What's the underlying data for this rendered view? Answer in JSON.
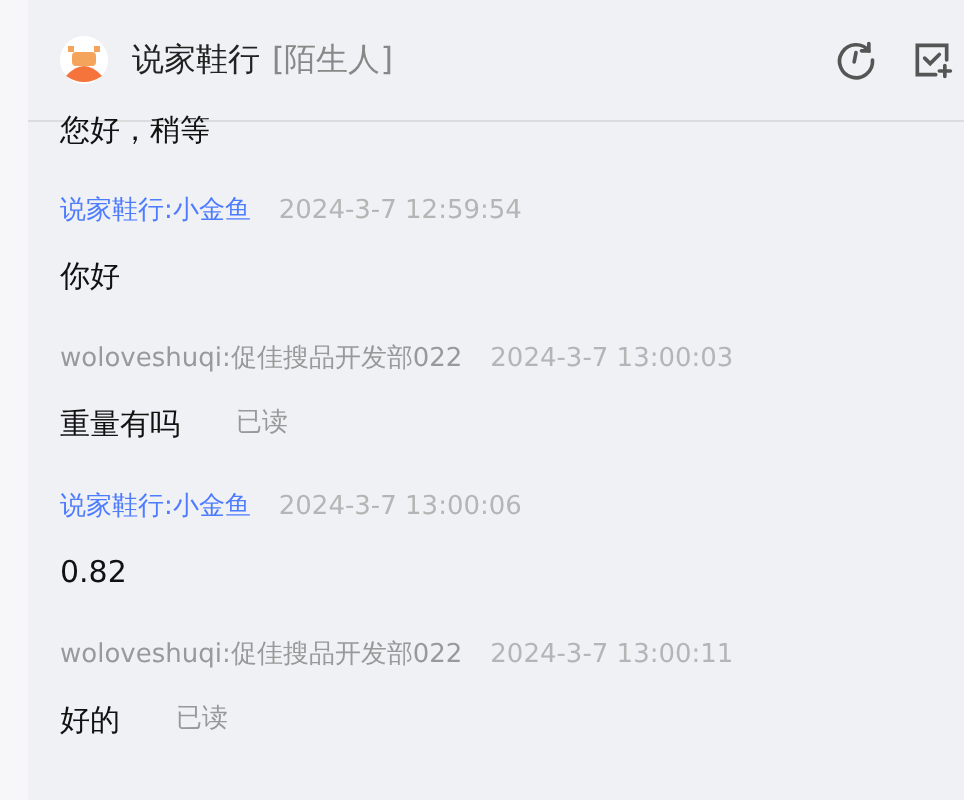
{
  "header": {
    "name": "说家鞋行",
    "tag": "[陌生人]"
  },
  "partial_message": "您好，稍等",
  "messages": [
    {
      "kind": "shop",
      "sender": "说家鞋行:小金鱼",
      "time": "2024-3-7 12:59:54",
      "text": "你好"
    },
    {
      "kind": "customer",
      "sender": "woloveshuqi:促佳搜品开发部022",
      "time": "2024-3-7 13:00:03",
      "text": "重量有吗",
      "status": "已读"
    },
    {
      "kind": "shop",
      "sender": "说家鞋行:小金鱼",
      "time": "2024-3-7 13:00:06",
      "text": "0.82"
    },
    {
      "kind": "customer",
      "sender": "woloveshuqi:促佳搜品开发部022",
      "time": "2024-3-7 13:00:11",
      "text": "好的",
      "status": "已读"
    }
  ]
}
